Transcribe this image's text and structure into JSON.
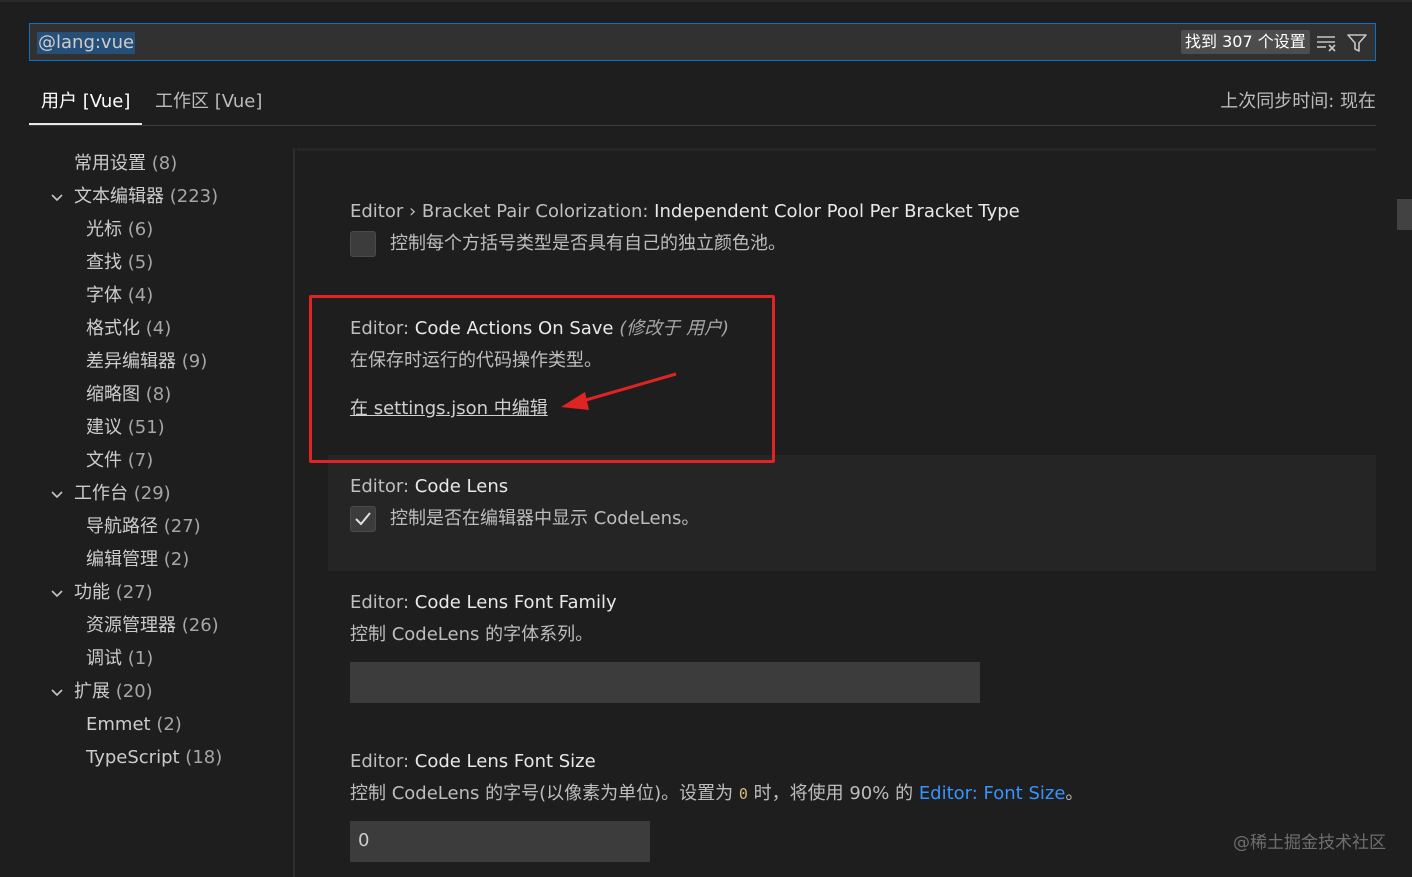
{
  "search": {
    "query": "@lang:vue",
    "result_count": "找到 307 个设置",
    "clear_filter_icon": "clear-filter-icon",
    "filter_icon": "filter-icon"
  },
  "tabs": [
    {
      "label": "用户 [Vue]",
      "active": true
    },
    {
      "label": "工作区 [Vue]",
      "active": false
    }
  ],
  "sync_status": "上次同步时间: 现在",
  "toc": [
    {
      "label": "常用设置",
      "count": "(8)"
    },
    {
      "label": "文本编辑器",
      "count": "(223)",
      "expanded": true
    },
    {
      "label": "光标",
      "count": "(6)"
    },
    {
      "label": "查找",
      "count": "(5)"
    },
    {
      "label": "字体",
      "count": "(4)"
    },
    {
      "label": "格式化",
      "count": "(4)"
    },
    {
      "label": "差异编辑器",
      "count": "(9)"
    },
    {
      "label": "缩略图",
      "count": "(8)"
    },
    {
      "label": "建议",
      "count": "(51)"
    },
    {
      "label": "文件",
      "count": "(7)"
    },
    {
      "label": "工作台",
      "count": "(29)",
      "expanded": true
    },
    {
      "label": "导航路径",
      "count": "(27)"
    },
    {
      "label": "编辑管理",
      "count": "(2)"
    },
    {
      "label": "功能",
      "count": "(27)",
      "expanded": true
    },
    {
      "label": "资源管理器",
      "count": "(26)"
    },
    {
      "label": "调试",
      "count": "(1)"
    },
    {
      "label": "扩展",
      "count": "(20)",
      "expanded": true
    },
    {
      "label": "Emmet",
      "count": "(2)"
    },
    {
      "label": "TypeScript",
      "count": "(18)"
    }
  ],
  "settings": {
    "bracket_pool": {
      "category": "Editor › Bracket Pair Colorization: ",
      "name": "Independent Color Pool Per Bracket Type",
      "description": "控制每个方括号类型是否具有自己的独立颜色池。",
      "checked": false
    },
    "code_actions": {
      "category": "Editor: ",
      "name": "Code Actions On Save",
      "modified": "(修改于 用户)",
      "description": "在保存时运行的代码操作类型。",
      "edit_link": "在 settings.json 中编辑"
    },
    "code_lens": {
      "category": "Editor: ",
      "name": "Code Lens",
      "description": "控制是否在编辑器中显示 CodeLens。",
      "checked": true
    },
    "code_lens_font_family": {
      "category": "Editor: ",
      "name": "Code Lens Font Family",
      "description": "控制 CodeLens 的字体系列。",
      "value": ""
    },
    "code_lens_font_size": {
      "category": "Editor: ",
      "name": "Code Lens Font Size",
      "desc_before": "控制 CodeLens 的字号(以像素为单位)。设置为 ",
      "desc_code": "0",
      "desc_middle": " 时，将使用 90% 的 ",
      "desc_link": "Editor: Font Size",
      "desc_after": "。",
      "value": "0"
    }
  },
  "watermark": "@稀土掘金技术社区",
  "colors": {
    "background": "#1e1e1e",
    "focus_border": "#0e70c0",
    "link": "#3794ff",
    "annotation": "#e02424"
  }
}
